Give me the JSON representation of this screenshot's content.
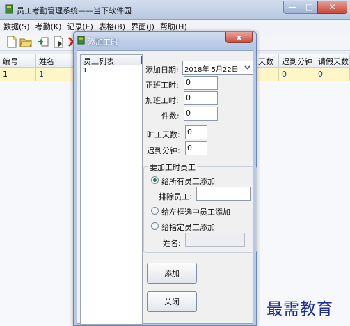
{
  "window": {
    "title": "员工考勤管理系统——当下软件园",
    "min": "—",
    "max": "□",
    "close": "✕"
  },
  "menu": [
    "数据(S)",
    "考勤(K)",
    "记录(E)",
    "表格(B)",
    "界面(J)",
    "帮助(H)"
  ],
  "toolbar": {
    "icons": [
      "new-doc-icon",
      "open-folder-icon",
      "import-icon",
      "export-icon",
      "delete-icon"
    ]
  },
  "grid": {
    "columns": [
      "编号",
      "姓名",
      "天数",
      "迟到分钟",
      "请假天数"
    ],
    "rows": [
      [
        "1",
        "1",
        "",
        "0",
        "0"
      ]
    ]
  },
  "dialog": {
    "title": "添加工时",
    "close": "x",
    "list_header": "员工列表",
    "list_items": [
      "1"
    ],
    "date_label": "添加日期:",
    "date_value": "2018年 5月22日",
    "fields": [
      {
        "label": "正班工时:",
        "value": "0"
      },
      {
        "label": "加班工时:",
        "value": "0"
      },
      {
        "label": "件数:",
        "value": "0"
      },
      {
        "label": "旷工天数:",
        "value": "0"
      },
      {
        "label": "迟到分钟:",
        "value": "0"
      }
    ],
    "group_title": "要加工时员工",
    "radio_all": "给所有员工添加",
    "exclude_label": "排除员工:",
    "exclude_value": "",
    "radio_left": "给左框选中员工添加",
    "radio_named": "给指定员工添加",
    "name_label": "姓名:",
    "name_value": "",
    "add_button": "添加",
    "close_button": "关闭"
  },
  "watermark": "最需教育",
  "colors": {
    "accent": "#2b5fa8",
    "selected_row": "#fff6c8",
    "watermark": "#1e2f9c"
  }
}
